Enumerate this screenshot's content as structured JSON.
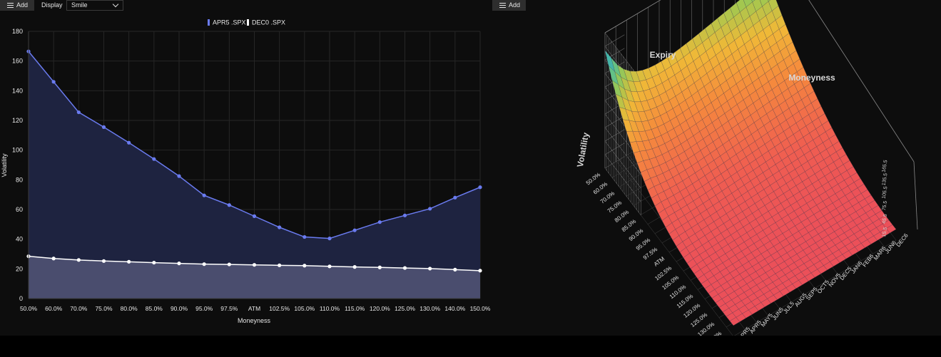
{
  "toolbar": {
    "add_label": "Add",
    "display_label": "Display",
    "display_value": "Smile"
  },
  "right_toolbar": {
    "add_label": "Add"
  },
  "colors": {
    "series_blue": "#6a7bf0",
    "series_white": "#ffffff",
    "blue_fill": "#1e2340",
    "white_fill": "#4a4d6e"
  },
  "chart_data": [
    {
      "type": "line",
      "xlabel": "Moneyness",
      "ylabel": "Volatility",
      "ylim": [
        0,
        180
      ],
      "yticks": [
        0,
        20,
        40,
        60,
        80,
        100,
        120,
        140,
        160,
        180
      ],
      "grid": true,
      "legend": "top-center",
      "categories": [
        "50.0%",
        "60.0%",
        "70.0%",
        "75.0%",
        "80.0%",
        "85.0%",
        "90.0%",
        "95.0%",
        "97.5%",
        "ATM",
        "102.5%",
        "105.0%",
        "110.0%",
        "115.0%",
        "120.0%",
        "125.0%",
        "130.0%",
        "140.0%",
        "150.0%"
      ],
      "series": [
        {
          "name": "APR5 .SPX",
          "color": "#6a7bf0",
          "values": [
            166.5,
            146,
            125.5,
            115.5,
            105,
            94,
            82.5,
            69.5,
            63,
            55.5,
            48,
            41.5,
            40.5,
            46,
            51.5,
            56,
            60.5,
            68,
            75
          ]
        },
        {
          "name": "DEC0 .SPX",
          "color": "#ffffff",
          "values": [
            28.5,
            27,
            26,
            25.3,
            24.8,
            24.2,
            23.7,
            23.2,
            23,
            22.7,
            22.4,
            22.2,
            21.7,
            21.3,
            21,
            20.6,
            20.2,
            19.5,
            18.8
          ]
        }
      ]
    },
    {
      "type": "surface",
      "zlabel": "Volatility",
      "xlabel": "Expiry",
      "ylabel": "Moneyness",
      "moneyness_ticks": [
        "50.0%",
        "60.0%",
        "70.0%",
        "75.0%",
        "80.0%",
        "85.0%",
        "90.0%",
        "95.0%",
        "97.5%",
        "ATM",
        "102.5%",
        "105.0%",
        "110.0%",
        "115.0%",
        "120.0%",
        "125.0%",
        "130.0%",
        "140.0%",
        "150.0%"
      ],
      "expiry_ticks": [
        "APR5",
        "APR5",
        "MAY5",
        "JUN5",
        "JUL5",
        "AUG5",
        "SEP5",
        "OCT5",
        "NOV5",
        "DEC5",
        "JAN6",
        "FEB6",
        "MAR6",
        "JUN6",
        "DEC6"
      ],
      "z_ticks": [
        "15.5",
        "45.5",
        "75.5",
        "105.5",
        "135.5",
        "165.5"
      ]
    }
  ]
}
